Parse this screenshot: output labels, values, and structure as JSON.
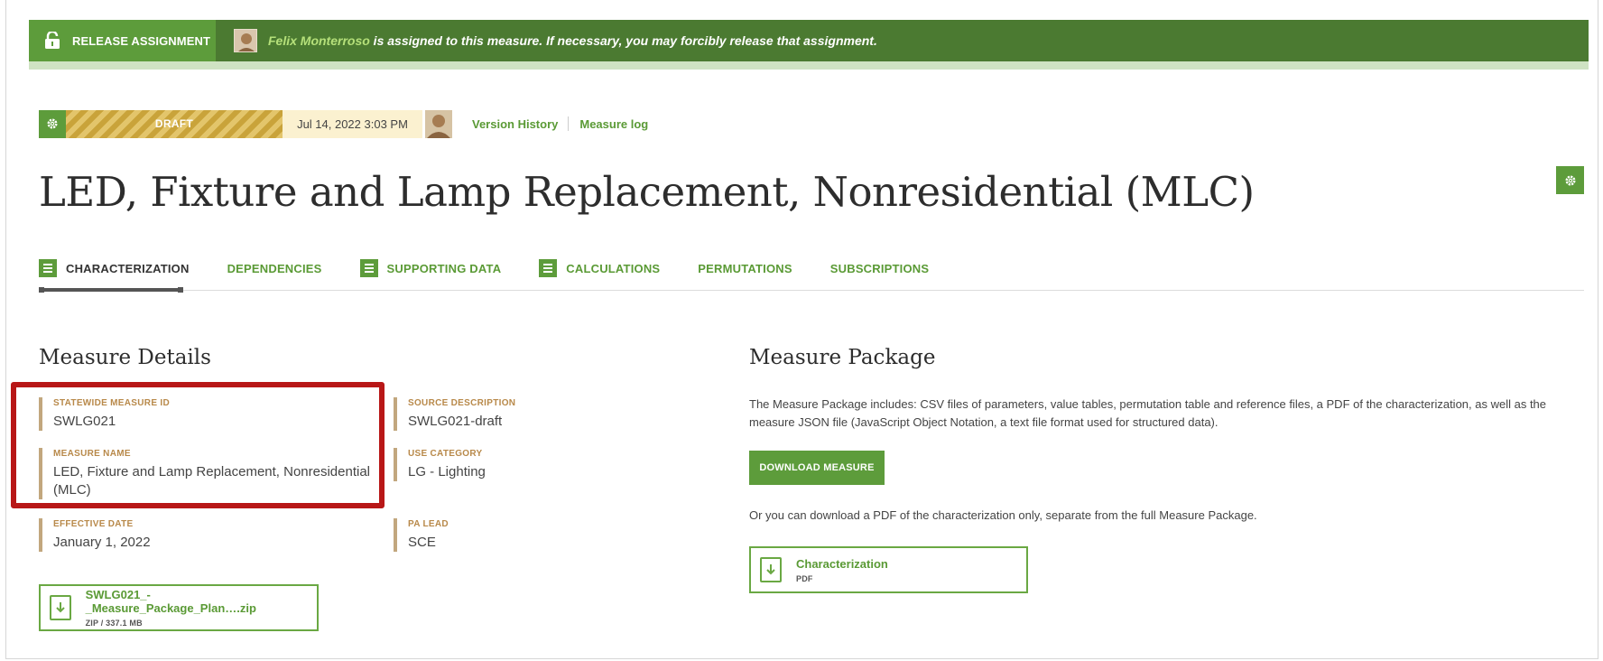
{
  "banner": {
    "release_label": "RELEASE ASSIGNMENT",
    "assignee": "Felix Monterroso",
    "message": " is assigned to this measure. If necessary, you may forcibly release that assignment."
  },
  "status": {
    "badge": "DRAFT",
    "datetime": "Jul 14, 2022 3:03 PM",
    "version_history": "Version History",
    "measure_log": "Measure log"
  },
  "page_title": "LED, Fixture and Lamp Replacement, Nonresidential (MLC)",
  "tabs": [
    {
      "label": "CHARACTERIZATION",
      "icon": "list-icon",
      "active": true
    },
    {
      "label": "DEPENDENCIES"
    },
    {
      "label": "SUPPORTING DATA",
      "icon": "list-icon"
    },
    {
      "label": "CALCULATIONS",
      "icon": "list-icon"
    },
    {
      "label": "PERMUTATIONS"
    },
    {
      "label": "SUBSCRIPTIONS"
    }
  ],
  "details": {
    "title": "Measure Details",
    "statewide_id_label": "STATEWIDE MEASURE ID",
    "statewide_id": "SWLG021",
    "measure_name_label": "MEASURE NAME",
    "measure_name_line1": "LED, Fixture and Lamp Replacement, Nonresidential",
    "measure_name_line2": "(MLC)",
    "effective_date_label": "EFFECTIVE DATE",
    "effective_date": "January 1, 2022",
    "source_desc_label": "SOURCE DESCRIPTION",
    "source_desc": "SWLG021-draft",
    "use_category_label": "USE CATEGORY",
    "use_category": "LG - Lighting",
    "pa_lead_label": "PA LEAD",
    "pa_lead": "SCE",
    "file": {
      "name": "SWLG021_-_Measure_Package_Plan….zip",
      "meta": "ZIP  /  337.1 MB"
    }
  },
  "package": {
    "title": "Measure Package",
    "description_line1": "The Measure Package includes: CSV files of parameters, value tables, permutation table and reference files, a PDF of the characterization, as well as the",
    "description_line2": "measure JSON file (JavaScript Object Notation, a text file format used for structured data).",
    "download_label": "DOWNLOAD MEASURE",
    "alt_text": "Or you can download a PDF of the characterization only, separate from the full Measure Package.",
    "file": {
      "name": "Characterization",
      "meta": "PDF"
    }
  },
  "colors": {
    "brand_green": "#5d9c3b",
    "banner_green": "#4b7a31",
    "highlight_red": "#b81717",
    "label_tan": "#b8894a"
  }
}
